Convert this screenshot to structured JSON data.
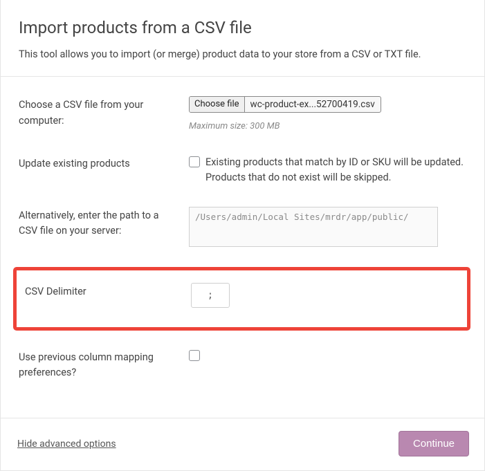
{
  "header": {
    "title": "Import products from a CSV file",
    "subtitle": "This tool allows you to import (or merge) product data to your store from a CSV or TXT file."
  },
  "form": {
    "file_row": {
      "label": "Choose a CSV file from your computer:",
      "choose_button": "Choose file",
      "file_name": "wc-product-ex...52700419.csv",
      "hint": "Maximum size: 300 MB"
    },
    "update_row": {
      "label": "Update existing products",
      "description": "Existing products that match by ID or SKU will be updated. Products that do not exist will be skipped."
    },
    "path_row": {
      "label": "Alternatively, enter the path to a CSV file on your server:",
      "value": "/Users/admin/Local Sites/mrdr/app/public/"
    },
    "delimiter_row": {
      "label": "CSV Delimiter",
      "value": ";"
    },
    "mapping_row": {
      "label": "Use previous column mapping preferences?"
    }
  },
  "footer": {
    "toggle_link": "Hide advanced options",
    "continue": "Continue"
  }
}
